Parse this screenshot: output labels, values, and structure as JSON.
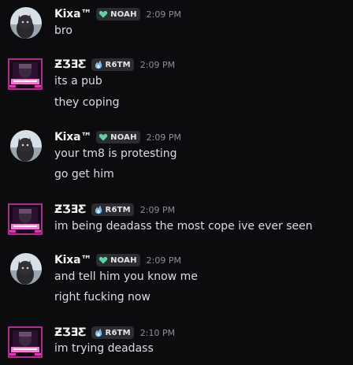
{
  "messages": [
    {
      "user": "Kixa™",
      "tag": "NOAH",
      "tag_icon": "heart-icon",
      "time": "2:09 PM",
      "lines": [
        "bro"
      ]
    },
    {
      "user": "ƵƷƎƸ",
      "tag": "R6TM",
      "tag_icon": "flame-icon",
      "time": "2:09 PM",
      "lines": [
        "its a pub",
        "they coping"
      ]
    },
    {
      "user": "Kixa™",
      "tag": "NOAH",
      "tag_icon": "heart-icon",
      "time": "2:09 PM",
      "lines": [
        "your tm8 is protesting",
        "go get him"
      ]
    },
    {
      "user": "ƵƷƎƸ",
      "tag": "R6TM",
      "tag_icon": "flame-icon",
      "time": "2:09 PM",
      "lines": [
        "im being deadass the most cope ive ever seen"
      ]
    },
    {
      "user": "Kixa™",
      "tag": "NOAH",
      "tag_icon": "heart-icon",
      "time": "2:09 PM",
      "lines": [
        "and tell him you know me",
        "right fucking now"
      ]
    },
    {
      "user": "ƵƷƎƸ",
      "tag": "R6TM",
      "tag_icon": "flame-icon",
      "time": "2:10 PM",
      "lines": [
        "im trying deadass"
      ]
    }
  ],
  "colors": {
    "background": "#0c0c0f",
    "username": "#f2f3f5",
    "tag_bg": "#2b2d31",
    "heart": "#5fd3a5",
    "flame": "#7fb7f0",
    "timestamp": "#8d9096",
    "text": "#dcdde1"
  }
}
